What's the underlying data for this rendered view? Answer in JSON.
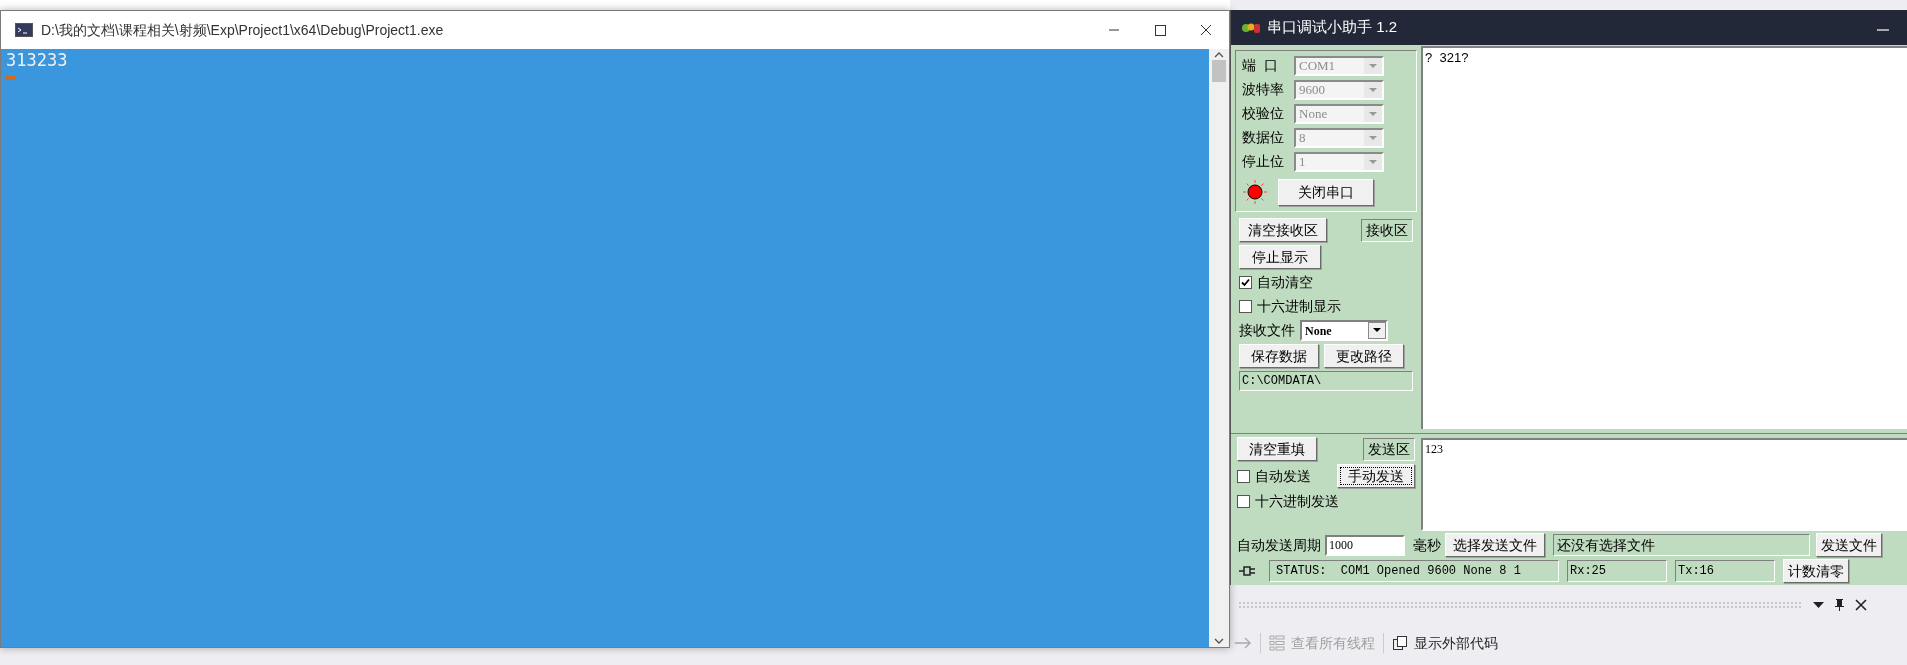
{
  "console": {
    "title": "D:\\我的文档\\课程相关\\射频\\Exp\\Project1\\x64\\Debug\\Project1.exe",
    "output": "313233"
  },
  "serial": {
    "title": "串口调试小助手 1.2",
    "settings": [
      {
        "label": "端  口",
        "value": "COM1"
      },
      {
        "label": "波特率",
        "value": "9600"
      },
      {
        "label": "校验位",
        "value": "None"
      },
      {
        "label": "数据位",
        "value": "8"
      },
      {
        "label": "停止位",
        "value": "1"
      }
    ],
    "port_open": true,
    "port_button": "关闭串口",
    "receive": {
      "clear_button": "清空接收区",
      "area_label": "接收区",
      "stop_button": "停止显示",
      "options": [
        {
          "label": "自动清空",
          "checked": true
        },
        {
          "label": "十六进制显示",
          "checked": false
        }
      ],
      "file_label": "接收文件",
      "file_value": "None",
      "save_button": "保存数据",
      "path_button": "更改路径",
      "path": "C:\\COMDATA\\",
      "text": "?  321?"
    },
    "send": {
      "clear_button": "清空重填",
      "area_label": "发送区",
      "manual_button": "手动发送",
      "options": [
        {
          "label": "自动发送",
          "checked": false
        },
        {
          "label": "十六进制发送",
          "checked": false
        }
      ],
      "text": "123",
      "period_label": "自动发送周期",
      "period": "1000",
      "unit": "毫秒",
      "choose_button": "选择发送文件",
      "file_status": "还没有选择文件",
      "send_file_button": "发送文件"
    },
    "status": "STATUS:  COM1 Opened 9600 None 8 1",
    "rx": "Rx:25",
    "tx": "Tx:16",
    "reset_button": "计数清零"
  },
  "ide_toolbar": {
    "threads_button": "查看所有线程",
    "external_code_button": "显示外部代码"
  }
}
